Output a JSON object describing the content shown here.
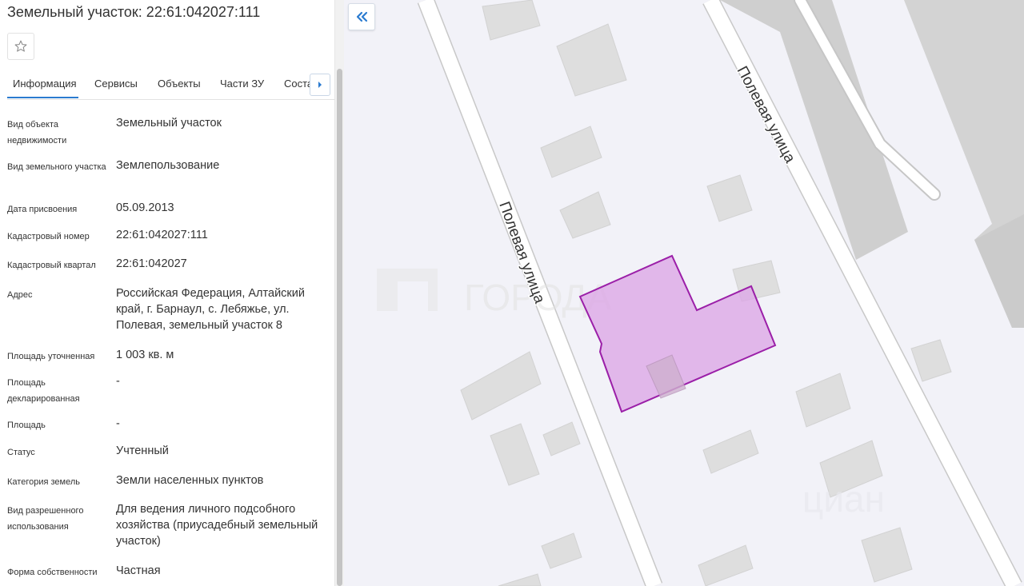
{
  "panel": {
    "title": "Земельный участок: 22:61:042027:111",
    "favorite_icon": "star-outline-icon"
  },
  "tabs": [
    {
      "label": "Информация",
      "active": true
    },
    {
      "label": "Сервисы",
      "active": false
    },
    {
      "label": "Объекты",
      "active": false
    },
    {
      "label": "Части ЗУ",
      "active": false
    },
    {
      "label": "Соста",
      "active": false
    }
  ],
  "tabs_scroll_icon": "chevron-right-icon",
  "fields": [
    {
      "label": "Вид объекта недвижимости",
      "value": "Земельный участок"
    },
    {
      "label": "Вид земельного участка",
      "value": "Землепользование"
    },
    {
      "label": "Дата присвоения",
      "value": "05.09.2013"
    },
    {
      "label": "Кадастровый номер",
      "value": "22:61:042027:111"
    },
    {
      "label": "Кадастровый квартал",
      "value": "22:61:042027"
    },
    {
      "label": "Адрес",
      "value": "Российская Федерация, Алтайский край, г. Барнаул, с. Лебяжье, ул. Полевая, земельный участок 8"
    },
    {
      "label": "Площадь уточненная",
      "value": "1 003 кв. м"
    },
    {
      "label": "Площадь декларированная",
      "value": "-"
    },
    {
      "label": "Площадь",
      "value": "-"
    },
    {
      "label": "Статус",
      "value": "Учтенный"
    },
    {
      "label": "Категория земель",
      "value": "Земли населенных пунктов"
    },
    {
      "label": "Вид разрешенного использования",
      "value": "Для ведения личного подсобного хозяйства (приусадебный земельный участок)"
    },
    {
      "label": "Форма собственности",
      "value": "Частная"
    }
  ],
  "map": {
    "collapse_icon": "double-chevron-left-icon",
    "street_label_1": "Полевая улица",
    "street_label_2": "Полевая улица",
    "watermark_1": "ГОРОДА",
    "watermark_2": "циан",
    "colors": {
      "background": "#f2f2f8",
      "building": "#dedede",
      "road": "#ffffff",
      "road_edge": "#c8c8c8",
      "industrial": "#cfcfcf",
      "parcel_fill": "#dca8e6",
      "parcel_stroke": "#9b1fa8",
      "collapse_icon": "#2b7bd0"
    }
  }
}
